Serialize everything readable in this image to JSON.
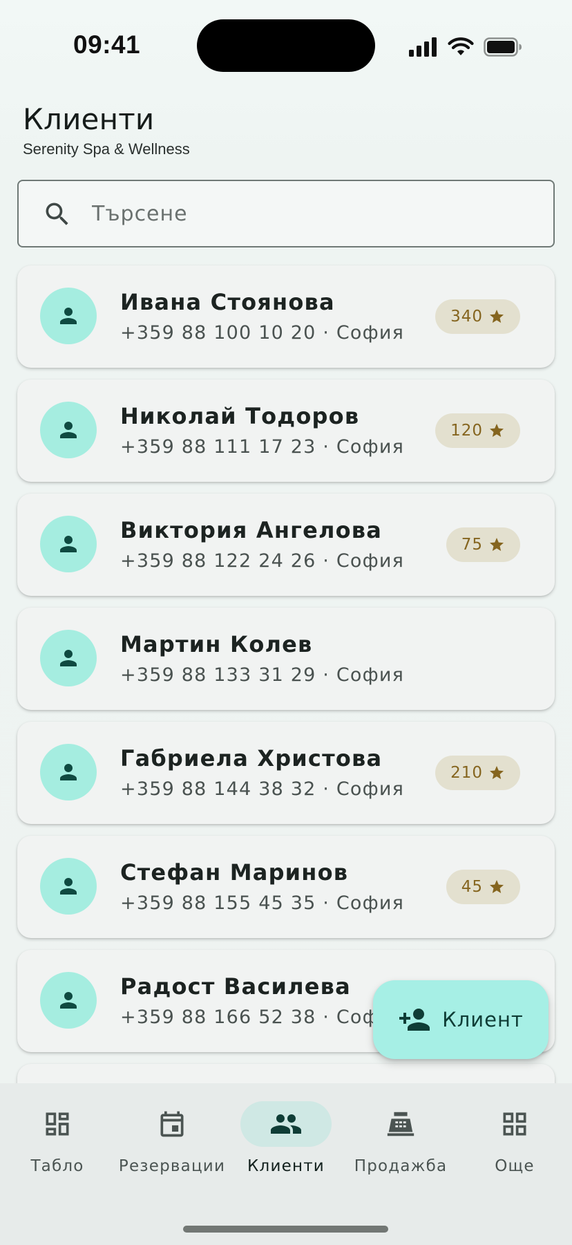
{
  "status_bar": {
    "time": "09:41"
  },
  "header": {
    "title": "Клиенти",
    "subtitle": "Serenity Spa & Wellness"
  },
  "search": {
    "placeholder": "Търсене",
    "value": ""
  },
  "clients": [
    {
      "name": "Ивана Стоянова",
      "info": "+359 88 100 10 20 · София",
      "points": "340"
    },
    {
      "name": "Николай Тодоров",
      "info": "+359 88 111 17 23 · София",
      "points": "120"
    },
    {
      "name": "Виктория Ангелова",
      "info": "+359 88 122 24 26 · София",
      "points": "75"
    },
    {
      "name": "Мартин Колев",
      "info": "+359 88 133 31 29 · София",
      "points": ""
    },
    {
      "name": "Габриела Христова",
      "info": "+359 88 144 38 32 · София",
      "points": "210"
    },
    {
      "name": "Стефан Маринов",
      "info": "+359 88 155 45 35 · София",
      "points": "45"
    },
    {
      "name": "Радост Василева",
      "info": "+359 88 166 52 38 · София",
      "points": ""
    }
  ],
  "fab": {
    "label": "Клиент",
    "icon": "person-add-icon"
  },
  "nav": {
    "items": [
      {
        "label": "Табло",
        "icon": "dashboard-icon",
        "active": false
      },
      {
        "label": "Резервации",
        "icon": "calendar-icon",
        "active": false
      },
      {
        "label": "Клиенти",
        "icon": "people-icon",
        "active": true
      },
      {
        "label": "Продажба",
        "icon": "cash-register-icon",
        "active": false
      },
      {
        "label": "Още",
        "icon": "apps-icon",
        "active": false
      }
    ]
  },
  "colors": {
    "accent": "#a6efe5",
    "avatar_bg": "#a5ede0",
    "badge_bg": "#e3e0cf",
    "badge_text": "#85651f",
    "nav_active_pill": "#cfe8e4"
  }
}
